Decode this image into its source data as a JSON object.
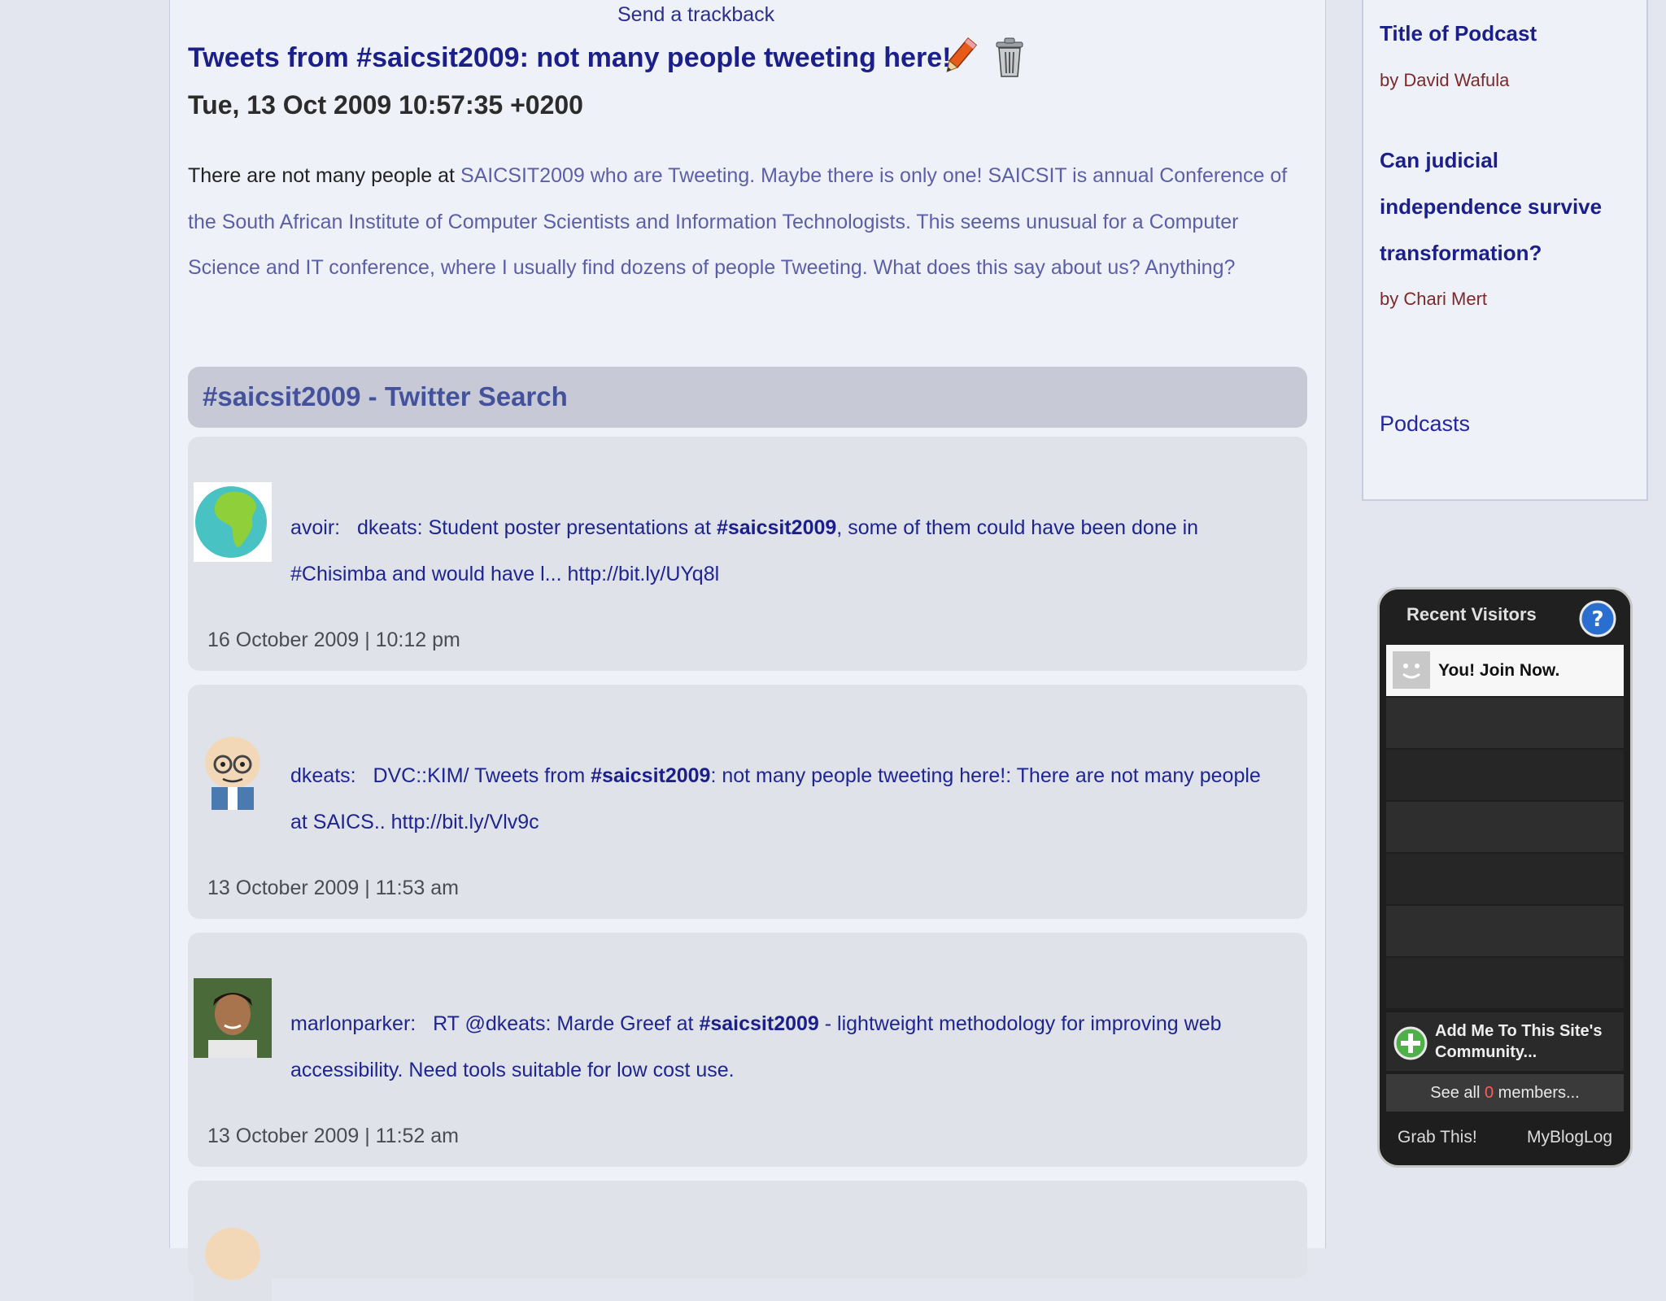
{
  "post": {
    "trackback_label": "Send a trackback",
    "title": "Tweets from #saicsit2009: not many people tweeting here!",
    "date": "Tue, 13 Oct 2009 10:57:35 +0200",
    "body_lead": "There are not many people at ",
    "body_rest": "SAICSIT2009 who are Tweeting. Maybe there is only one! SAICSIT is annual Conference of the South African Institute of Computer Scientists and Information Technologists. This seems unusual for a Computer Science and IT conference, where I usually find dozens of people Tweeting. What does this say about us? Anything?"
  },
  "twitter": {
    "header": "#saicsit2009 - Twitter Search",
    "tweets": [
      {
        "user": "avoir:",
        "pre": "dkeats: Student poster presentations at ",
        "tag": "#saicsit2009",
        "post": ", some of them could have been done in #Chisimba and would have l... http://bit.ly/UYq8l",
        "time": "16 October 2009 | 10:12 pm"
      },
      {
        "user": "dkeats:",
        "pre": "DVC::KIM/ Tweets from ",
        "tag": "#saicsit2009",
        "post": ": not many people tweeting here!: There are not many people at SAICS.. http://bit.ly/Vlv9c",
        "time": "13 October 2009 | 11:53 am"
      },
      {
        "user": "marlonparker:",
        "pre": "RT @dkeats: Marde Greef at ",
        "tag": "#saicsit2009",
        "post": " - lightweight methodology for improving web accessibility. Need tools suitable for low cost use.",
        "time": "13 October 2009 | 11:52 am"
      }
    ]
  },
  "sidebar": {
    "items": [
      {
        "title": "Title of Podcast",
        "author": "by David Wafula"
      },
      {
        "title": "Can judicial independence survive transformation?",
        "author": "by Chari Mert"
      }
    ],
    "podcasts_link": "Podcasts"
  },
  "widget": {
    "title": "Recent Visitors",
    "visitor_label": "You! Join Now.",
    "add_label": "Add Me To This Site's Community...",
    "see_all_pre": "See all ",
    "see_all_count": "0",
    "see_all_post": " members...",
    "grab_label": "Grab This!",
    "mybloglog_label": "MyBlogLog"
  },
  "icons": {
    "edit": "pencil-icon",
    "delete": "trash-icon",
    "help": "help-icon",
    "add": "plus-icon"
  }
}
